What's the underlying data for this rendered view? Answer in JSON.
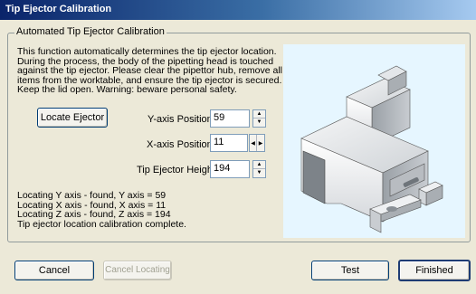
{
  "window": {
    "title": "Tip Ejector Calibration"
  },
  "group": {
    "legend": "Automated Tip Ejector Calibration",
    "description_lines": [
      "This function automatically determines the tip ejector location.",
      "During the process, the body of the pipetting head is touched",
      "against the tip ejector. Please clear the pipettor hub, remove all",
      "items from the worktable, and ensure the tip ejector is secured.",
      "Keep the lid open. Warning: beware personal safety."
    ],
    "locate_button": "Locate Ejector",
    "y_axis": {
      "label": "Y-axis Position",
      "value": "59"
    },
    "x_axis": {
      "label": "X-axis Position",
      "value": "11"
    },
    "tip_height": {
      "label": "Tip Ejector Height",
      "value": "194"
    },
    "status_lines": [
      "Locating Y axis - found, Y axis = 59",
      "Locating X axis - found, X axis = 11",
      "Locating Z axis - found, Z axis = 194",
      "Tip ejector location calibration complete."
    ]
  },
  "buttons": {
    "cancel": "Cancel",
    "cancel_locating": "Cancel Locating",
    "test": "Test",
    "finished": "Finished"
  },
  "colors": {
    "title_start": "#0a246a",
    "title_end": "#a6caf0",
    "picture_bg": "#e6f6ff"
  }
}
